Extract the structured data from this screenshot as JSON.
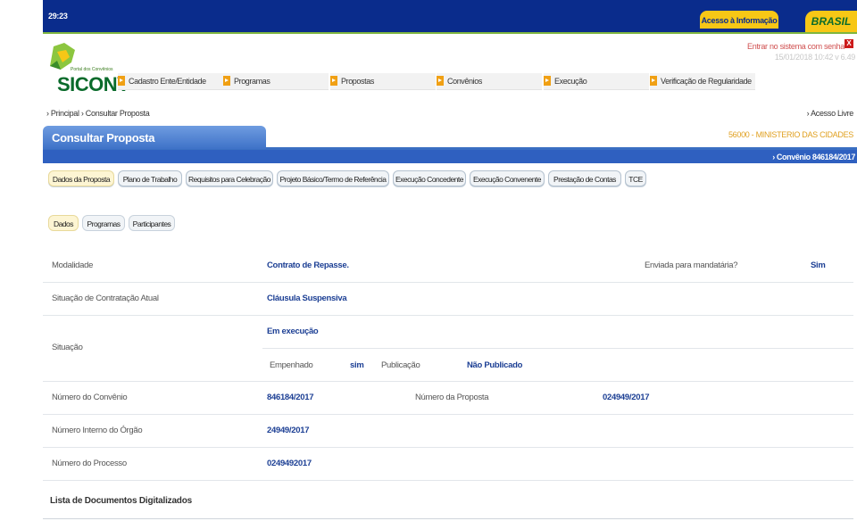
{
  "gov_bar": {
    "time": "29:23",
    "acesso_informacao": "Acesso à Informação",
    "brasil": "BRASIL"
  },
  "header": {
    "logo_subtitle": "Portal dos Convênios",
    "logo_title": "SICONV",
    "login_link": "Entrar no sistema com senha",
    "close_label": "X",
    "datetime": "15/01/2018 10:42 v 6.49"
  },
  "menu": [
    {
      "label": "Cadastro Ente/Entidade"
    },
    {
      "label": "Programas"
    },
    {
      "label": "Propostas"
    },
    {
      "label": "Convênios"
    },
    {
      "label": "Execução"
    },
    {
      "label": "Verificação de Regularidade"
    }
  ],
  "breadcrumb": {
    "items": [
      "Principal",
      "Consultar Proposta"
    ],
    "text": "› Principal › Consultar Proposta",
    "acesso_livre": "› Acesso Livre"
  },
  "page": {
    "title": "Consultar Proposta",
    "ministerio": "56000 - MINISTERIO DAS CIDADES",
    "convenio_label": "› Convênio 846184/2017"
  },
  "tabs": [
    {
      "label": "Dados da Proposta",
      "active": true
    },
    {
      "label": "Plano de Trabalho"
    },
    {
      "label": "Requisitos para Celebração"
    },
    {
      "label": "Projeto Básico/Termo de Referência"
    },
    {
      "label": "Execução Concedente"
    },
    {
      "label": "Execução Convenente"
    },
    {
      "label": "Prestação de Contas"
    },
    {
      "label": "TCE"
    }
  ],
  "subtabs": [
    {
      "label": "Dados",
      "active": true
    },
    {
      "label": "Programas"
    },
    {
      "label": "Participantes"
    }
  ],
  "fields": {
    "modalidade": {
      "label": "Modalidade",
      "value": "Contrato de Repasse."
    },
    "mandataria": {
      "label": "Enviada para mandatária?",
      "value": "Sim"
    },
    "situacao_contratacao": {
      "label": "Situação de Contratação Atual",
      "value": "Cláusula Suspensiva"
    },
    "situacao": {
      "label": "Situação",
      "value": "Em execução"
    },
    "empenhado": {
      "label": "Empenhado",
      "value": "sim"
    },
    "publicacao": {
      "label": "Publicação",
      "value": "Não Publicado"
    },
    "numero_convenio": {
      "label": "Número do Convênio",
      "value": "846184/2017"
    },
    "numero_proposta": {
      "label": "Número da Proposta",
      "value": "024949/2017"
    },
    "numero_interno": {
      "label": "Número Interno do Órgão",
      "value": "24949/2017"
    },
    "numero_processo": {
      "label": "Número do Processo",
      "value": "0249492017"
    }
  },
  "documents": {
    "title": "Lista de Documentos Digitalizados"
  },
  "colors": {
    "gov_blue": "#0a2c8c",
    "gov_yellow": "#f7c716",
    "title_blue": "#3e72c8",
    "value_blue": "#1c3f94",
    "menu_icon_orange": "#f0a014",
    "ministerio_orange": "#e0a020"
  }
}
